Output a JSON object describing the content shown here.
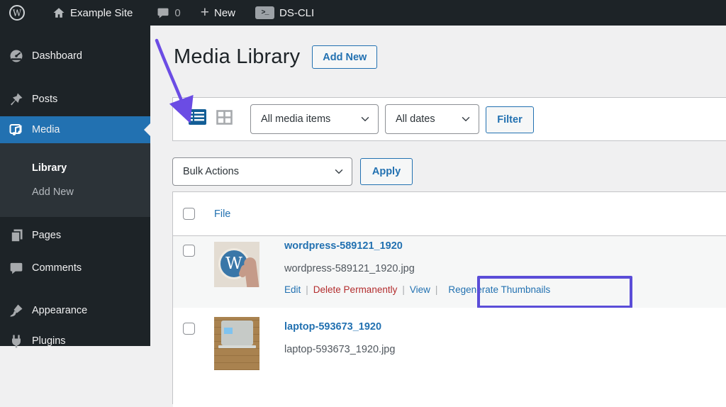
{
  "admin_bar": {
    "site_name": "Example Site",
    "comments_count": "0",
    "new_label": "New",
    "cli_label": "DS-CLI",
    "wp_logo_glyph": "W",
    "terminal_glyph": ">_",
    "plus_glyph": "+"
  },
  "sidebar": {
    "items": [
      {
        "label": "Dashboard"
      },
      {
        "label": "Posts"
      },
      {
        "label": "Media"
      },
      {
        "label": "Pages"
      },
      {
        "label": "Comments"
      },
      {
        "label": "Appearance"
      },
      {
        "label": "Plugins"
      }
    ],
    "submenu": [
      {
        "label": "Library"
      },
      {
        "label": "Add New"
      }
    ]
  },
  "page": {
    "title": "Media Library",
    "add_new_label": "Add New"
  },
  "filters": {
    "media_type_value": "All media items",
    "date_value": "All dates",
    "filter_label": "Filter"
  },
  "bulk_actions": {
    "value": "Bulk Actions",
    "apply_label": "Apply"
  },
  "table": {
    "file_header": "File",
    "separator": "|",
    "rows": [
      {
        "title": "wordpress-589121_1920",
        "filename": "wordpress-589121_1920.jpg",
        "badge_glyph": "W",
        "actions": [
          "Edit",
          "Delete Permanently",
          "View",
          "Regenerate Thumbnails"
        ]
      },
      {
        "title": "laptop-593673_1920",
        "filename": "laptop-593673_1920.jpg"
      }
    ]
  },
  "colors": {
    "accent_blue": "#2271b1",
    "active_icon_blue": "#135e96",
    "annotation_purple": "#5b4dd8",
    "delete_red": "#b32d2e",
    "sidebar_dark": "#1d2327",
    "content_bg": "#f0f0f1"
  }
}
